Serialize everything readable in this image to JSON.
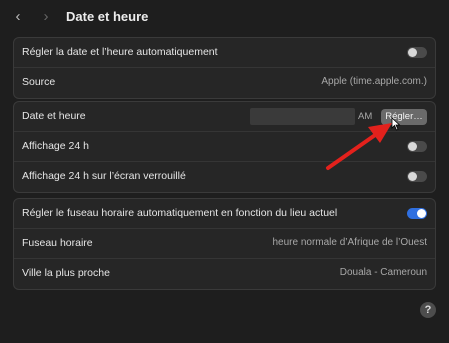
{
  "header": {
    "title": "Date et heure",
    "back_icon": "‹",
    "forward_icon": "›"
  },
  "group1": {
    "auto_label": "Régler la date et l’heure automatiquement",
    "auto_on": false,
    "source_label": "Source",
    "source_value": "Apple (time.apple.com.)"
  },
  "group2": {
    "datetime_label": "Date et heure",
    "ampm": "AM",
    "set_button": "Régler…",
    "h24_label": "Affichage 24 h",
    "h24_on": false,
    "h24_lock_label": "Affichage 24 h sur l’écran verrouillé",
    "h24_lock_on": false
  },
  "group3": {
    "auto_tz_label": "Régler le fuseau horaire automatiquement en fonction du lieu actuel",
    "auto_tz_on": true,
    "tz_label": "Fuseau horaire",
    "tz_value": "heure normale d’Afrique de l’Ouest",
    "city_label": "Ville la plus proche",
    "city_value": "Douala - Cameroun"
  },
  "footer": {
    "help_label": "?"
  },
  "colors": {
    "accent": "#2f6fe0",
    "annotation_arrow": "#e3211c"
  }
}
